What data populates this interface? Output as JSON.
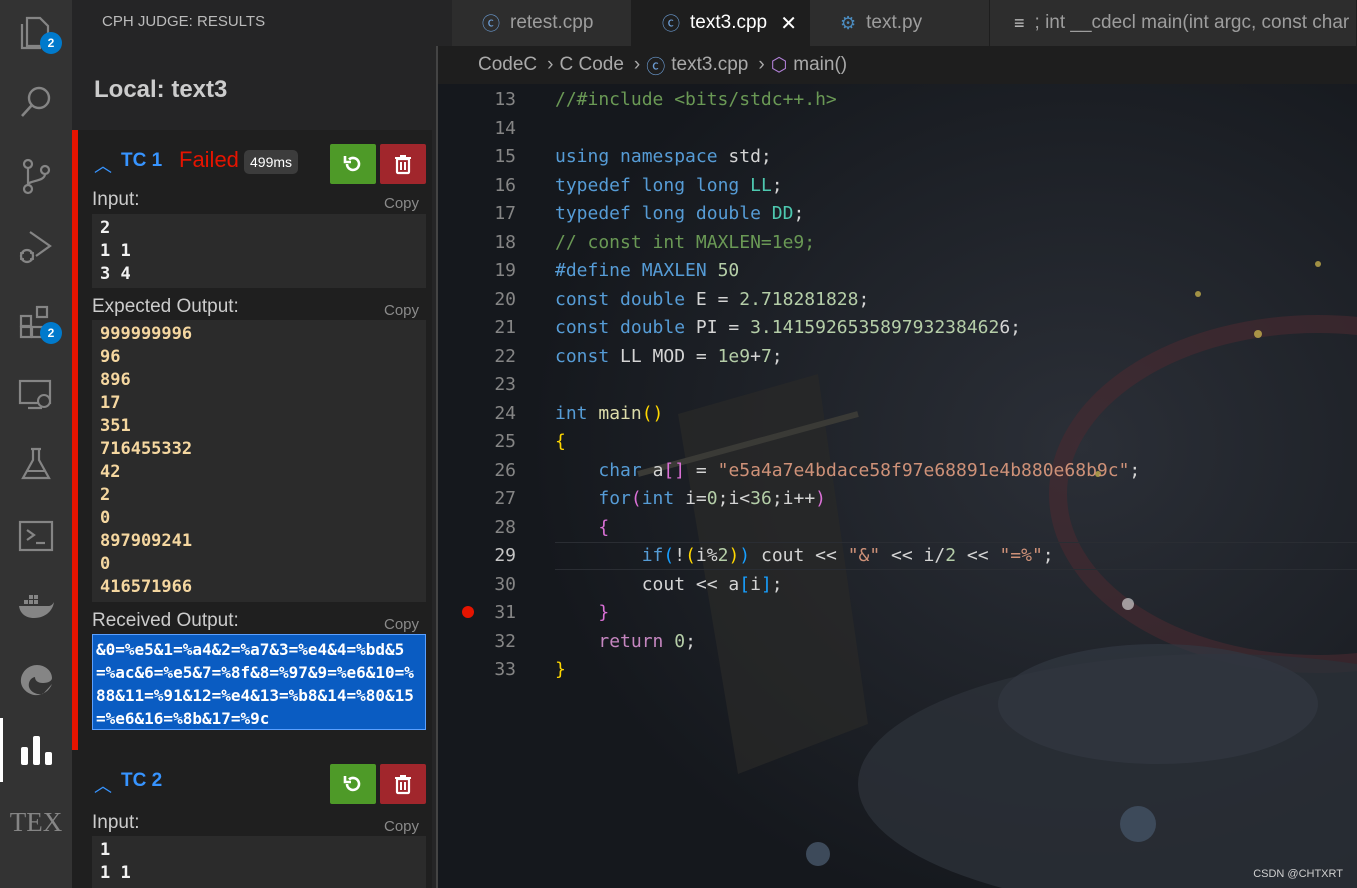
{
  "activity_bar": {
    "items": [
      {
        "icon": "files-icon",
        "badge": "2"
      },
      {
        "icon": "search-icon"
      },
      {
        "icon": "source-control-icon"
      },
      {
        "icon": "run-debug-icon"
      },
      {
        "icon": "extensions-icon",
        "badge": "2"
      },
      {
        "icon": "remote-explorer-icon"
      },
      {
        "icon": "testing-flask-icon"
      },
      {
        "icon": "terminal-icon"
      },
      {
        "icon": "docker-icon"
      },
      {
        "icon": "edge-icon"
      },
      {
        "icon": "cph-judge-icon"
      },
      {
        "icon": "tex-icon",
        "label": "TEX"
      }
    ]
  },
  "sidebar": {
    "title": "CPH JUDGE: RESULTS",
    "heading": "Local: text3",
    "testcases": [
      {
        "name": "TC 1",
        "status": "Failed",
        "time": "499ms",
        "input_label": "Input:",
        "input": "2\n1 1\n3 4",
        "expected_label": "Expected Output:",
        "expected": "999999996\n96\n896\n17\n351\n716455332\n42\n2\n0\n897909241\n0\n416571966",
        "received_label": "Received Output:",
        "received": "&0=%e5&1=%a4&2=%a7&3=%e4&4=%bd&5=%ac&6=%e5&7=%8f&8=%97&9=%e6&10=%88&11=%91&12=%e4&13=%b8&14=%80&15=%e6&16=%8b&17=%9c",
        "copy_label": "Copy"
      },
      {
        "name": "TC 2",
        "input_label": "Input:",
        "input": "1\n1 1",
        "copy_label": "Copy"
      }
    ]
  },
  "editor": {
    "tabs": [
      {
        "label": "retest.cpp",
        "icon": "cpp-icon"
      },
      {
        "label": "text3.cpp",
        "icon": "cpp-icon",
        "active": true,
        "close": "✕"
      },
      {
        "label": "text.py",
        "icon": "python-icon"
      },
      {
        "label": "; int __cdecl main(int argc, const char",
        "icon": "outline-icon"
      }
    ],
    "breadcrumb": [
      "CodeC",
      "C Code",
      "text3.cpp",
      "main()"
    ],
    "line_numbers": [
      "13",
      "14",
      "15",
      "16",
      "17",
      "18",
      "19",
      "20",
      "21",
      "22",
      "23",
      "24",
      "25",
      "26",
      "27",
      "28",
      "29",
      "30",
      "31",
      "32",
      "33"
    ],
    "current_line": "29",
    "breakpoint_line": "31",
    "watermark": "CSDN @CHTXRT"
  }
}
